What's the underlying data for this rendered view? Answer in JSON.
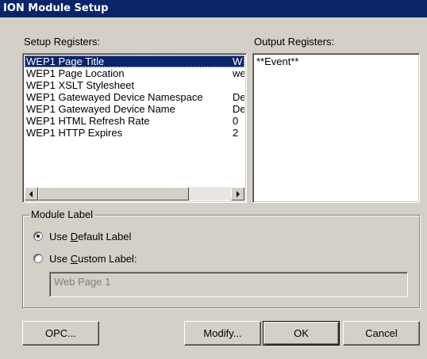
{
  "window": {
    "title": "ION Module Setup"
  },
  "setup_registers": {
    "label": "Setup Registers:",
    "items": [
      {
        "name": "WEP1 Page Title",
        "value": "W",
        "selected": true
      },
      {
        "name": "WEP1 Page Location",
        "value": "we"
      },
      {
        "name": "WEP1 XSLT Stylesheet",
        "value": ""
      },
      {
        "name": "WEP1 Gatewayed Device Namespace",
        "value": "De"
      },
      {
        "name": "WEP1 Gatewayed Device Name",
        "value": "De"
      },
      {
        "name": "WEP1 HTML Refresh Rate",
        "value": "0"
      },
      {
        "name": "WEP1 HTTP Expires",
        "value": "2"
      }
    ],
    "scroll_fraction": 0.0
  },
  "output_registers": {
    "label": "Output Registers:",
    "items": [
      "**Event**"
    ]
  },
  "module_label": {
    "title": "Module Label",
    "option_default": {
      "pre": "Use ",
      "accel": "D",
      "post": "efault Label",
      "checked": true
    },
    "option_custom": {
      "pre": "Use ",
      "accel": "C",
      "post": "ustom Label:",
      "checked": false
    },
    "custom_value": "Web Page 1"
  },
  "buttons": {
    "opc": "OPC...",
    "modify": "Modify...",
    "ok": "OK",
    "cancel": "Cancel"
  },
  "colors": {
    "titlebar": "#0a246a",
    "face": "#d4d0c8",
    "selection": "#0a246a"
  }
}
